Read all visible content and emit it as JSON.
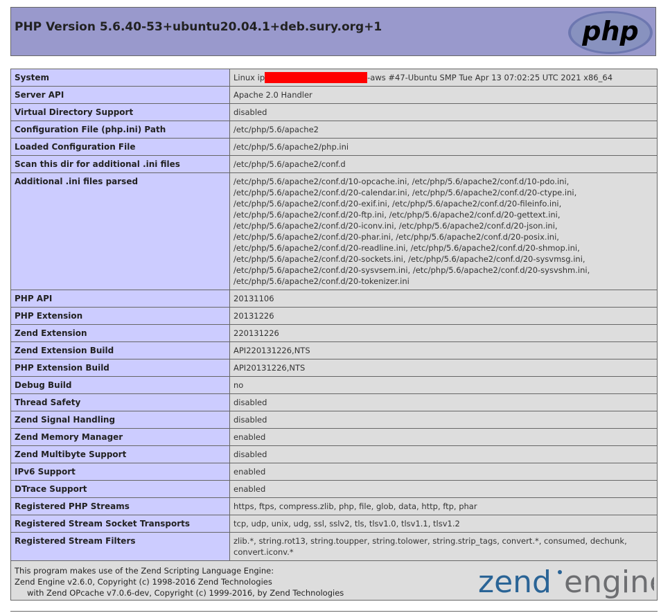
{
  "header": {
    "title": "PHP Version 5.6.40-53+ubuntu20.04.1+deb.sury.org+1",
    "logo_text": "php"
  },
  "system": {
    "label": "System",
    "prefix": "Linux ip",
    "suffix": "-aws #47-Ubuntu SMP Tue Apr 13 07:02:25 UTC 2021 x86_64"
  },
  "rows_a": [
    {
      "label": "Server API",
      "value": "Apache 2.0 Handler"
    },
    {
      "label": "Virtual Directory Support",
      "value": "disabled"
    },
    {
      "label": "Configuration File (php.ini) Path",
      "value": "/etc/php/5.6/apache2"
    },
    {
      "label": "Loaded Configuration File",
      "value": "/etc/php/5.6/apache2/php.ini"
    },
    {
      "label": "Scan this dir for additional .ini files",
      "value": "/etc/php/5.6/apache2/conf.d"
    }
  ],
  "ini_parsed": {
    "label": "Additional .ini files parsed",
    "lines": [
      "/etc/php/5.6/apache2/conf.d/10-opcache.ini, /etc/php/5.6/apache2/conf.d/10-pdo.ini,",
      "/etc/php/5.6/apache2/conf.d/20-calendar.ini, /etc/php/5.6/apache2/conf.d/20-ctype.ini,",
      "/etc/php/5.6/apache2/conf.d/20-exif.ini, /etc/php/5.6/apache2/conf.d/20-fileinfo.ini,",
      "/etc/php/5.6/apache2/conf.d/20-ftp.ini, /etc/php/5.6/apache2/conf.d/20-gettext.ini,",
      "/etc/php/5.6/apache2/conf.d/20-iconv.ini, /etc/php/5.6/apache2/conf.d/20-json.ini,",
      "/etc/php/5.6/apache2/conf.d/20-phar.ini, /etc/php/5.6/apache2/conf.d/20-posix.ini,",
      "/etc/php/5.6/apache2/conf.d/20-readline.ini, /etc/php/5.6/apache2/conf.d/20-shmop.ini,",
      "/etc/php/5.6/apache2/conf.d/20-sockets.ini, /etc/php/5.6/apache2/conf.d/20-sysvmsg.ini,",
      "/etc/php/5.6/apache2/conf.d/20-sysvsem.ini, /etc/php/5.6/apache2/conf.d/20-sysvshm.ini,",
      "/etc/php/5.6/apache2/conf.d/20-tokenizer.ini"
    ]
  },
  "rows_b": [
    {
      "label": "PHP API",
      "value": "20131106"
    },
    {
      "label": "PHP Extension",
      "value": "20131226"
    },
    {
      "label": "Zend Extension",
      "value": "220131226"
    },
    {
      "label": "Zend Extension Build",
      "value": "API220131226,NTS"
    },
    {
      "label": "PHP Extension Build",
      "value": "API20131226,NTS"
    },
    {
      "label": "Debug Build",
      "value": "no"
    },
    {
      "label": "Thread Safety",
      "value": "disabled"
    },
    {
      "label": "Zend Signal Handling",
      "value": "disabled"
    },
    {
      "label": "Zend Memory Manager",
      "value": "enabled"
    },
    {
      "label": "Zend Multibyte Support",
      "value": "disabled"
    },
    {
      "label": "IPv6 Support",
      "value": "enabled"
    },
    {
      "label": "DTrace Support",
      "value": "enabled"
    },
    {
      "label": "Registered PHP Streams",
      "value": "https, ftps, compress.zlib, php, file, glob, data, http, ftp, phar"
    },
    {
      "label": "Registered Stream Socket Transports",
      "value": "tcp, udp, unix, udg, ssl, sslv2, tls, tlsv1.0, tlsv1.1, tlsv1.2"
    },
    {
      "label": "Registered Stream Filters",
      "value": "zlib.*, string.rot13, string.toupper, string.tolower, string.strip_tags, convert.*, consumed, dechunk, convert.iconv.*"
    }
  ],
  "footer": {
    "line1": "This program makes use of the Zend Scripting Language Engine:",
    "line2": "Zend Engine v2.6.0, Copyright (c) 1998-2016 Zend Technologies",
    "line3": "with Zend OPcache v7.0.6-dev, Copyright (c) 1999-2016, by Zend Technologies",
    "logo_word1": "zend",
    "logo_word2": "engine"
  },
  "colors": {
    "header_bg": "#9999cc",
    "label_bg": "#ccccff",
    "value_bg": "#dddddd",
    "redaction": "#ff0000",
    "zend_blue": "#2a6496",
    "zend_gray": "#6d6e71"
  }
}
